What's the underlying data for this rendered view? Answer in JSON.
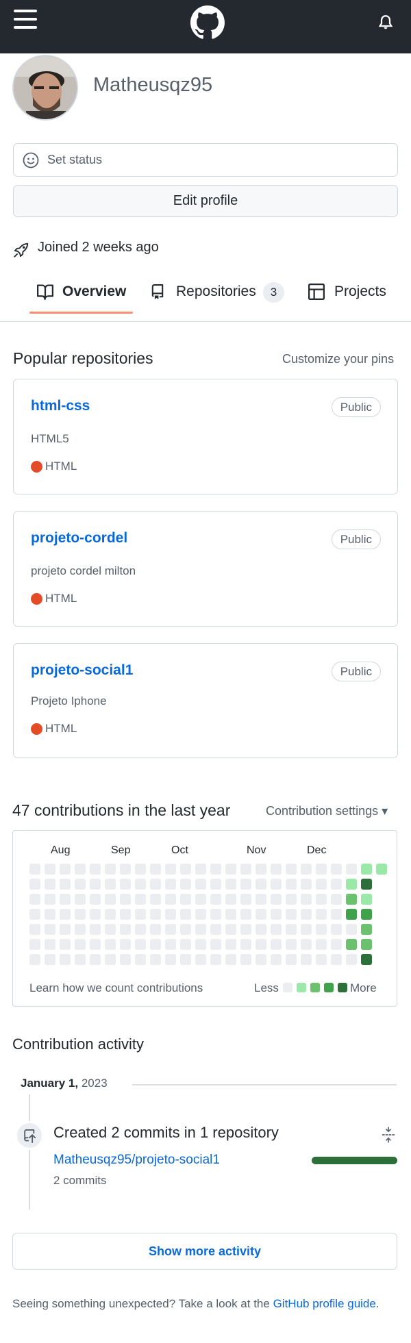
{
  "header": {
    "menu_icon": "hamburger-menu-icon",
    "logo_icon": "github-octocat-icon",
    "bell_icon": "notification-bell-icon"
  },
  "profile": {
    "username": "Matheusqz95",
    "set_status": "Set status",
    "edit_profile": "Edit profile",
    "joined": "Joined 2 weeks ago"
  },
  "tabs": [
    {
      "label": "Overview",
      "icon": "book-icon",
      "selected": true
    },
    {
      "label": "Repositories",
      "icon": "repo-icon",
      "count": "3"
    },
    {
      "label": "Projects",
      "icon": "table-icon"
    }
  ],
  "popular": {
    "title": "Popular repositories",
    "customize": "Customize your pins",
    "repos": [
      {
        "name": "html-css",
        "visibility": "Public",
        "description": "HTML5",
        "language": "HTML",
        "language_color": "#e34c26"
      },
      {
        "name": "projeto-cordel",
        "visibility": "Public",
        "description": "projeto cordel milton",
        "language": "HTML",
        "language_color": "#e34c26"
      },
      {
        "name": "projeto-social1",
        "visibility": "Public",
        "description": "Projeto Iphone",
        "language": "HTML",
        "language_color": "#e34c26"
      }
    ]
  },
  "contributions": {
    "title": "47 contributions in the last year",
    "settings": "Contribution settings ▾",
    "months": [
      "Aug",
      "Sep",
      "Oct",
      "Nov",
      "Dec"
    ],
    "learn": "Learn how we count contributions",
    "less": "Less",
    "more": "More",
    "colors": [
      "#ebedf0",
      "#9be9a8",
      "#6cc16f",
      "#40a24a",
      "#2c6f3b"
    ],
    "recent_weeks": [
      {
        "week": "second-to-last",
        "levels": [
          0,
          1,
          2,
          3,
          0,
          2,
          0
        ]
      },
      {
        "week": "last",
        "levels": [
          1,
          4,
          1,
          3,
          2,
          2,
          4
        ]
      }
    ]
  },
  "activity": {
    "title": "Contribution activity",
    "date_month": "January 1,",
    "date_year": "2023",
    "commit_title": "Created 2 commits in 1 repository",
    "repo": "Matheusqz95/projeto-social1",
    "commits": "2 commits",
    "show_more": "Show more activity"
  },
  "footer": {
    "text": "Seeing something unexpected? Take a look at the",
    "link": "GitHub profile guide",
    "end": "."
  }
}
